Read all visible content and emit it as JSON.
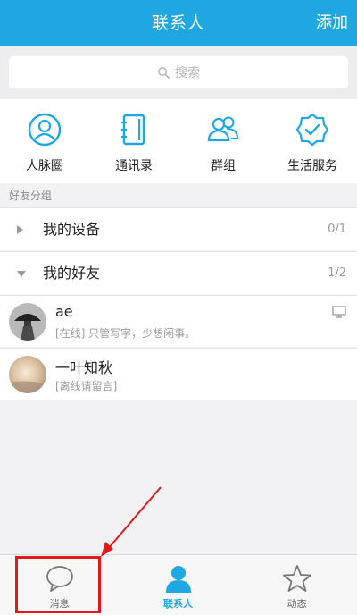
{
  "header": {
    "title": "联系人",
    "add_label": "添加"
  },
  "search": {
    "placeholder": "搜索"
  },
  "quick_entries": [
    {
      "label": "人脉圈",
      "icon": "contacts-circle-icon"
    },
    {
      "label": "通讯录",
      "icon": "address-book-icon"
    },
    {
      "label": "群组",
      "icon": "group-icon"
    },
    {
      "label": "生活服务",
      "icon": "service-badge-icon"
    }
  ],
  "section_label": "好友分组",
  "groups": [
    {
      "name": "我的设备",
      "count": "0/1",
      "expanded": false
    },
    {
      "name": "我的好友",
      "count": "1/2",
      "expanded": true
    }
  ],
  "friends": [
    {
      "name": "ae",
      "signature": "[在线] 只管写字，少想闲事。",
      "status": "online"
    },
    {
      "name": "一叶知秋",
      "signature": "[离线请留言]",
      "status": "offline"
    }
  ],
  "tabs": [
    {
      "label": "消息",
      "icon": "chat-bubble-icon",
      "active": false
    },
    {
      "label": "联系人",
      "icon": "person-icon",
      "active": true
    },
    {
      "label": "动态",
      "icon": "star-icon",
      "active": false
    }
  ],
  "colors": {
    "brand": "#1fa7e1",
    "highlight": "#e01a1a"
  }
}
